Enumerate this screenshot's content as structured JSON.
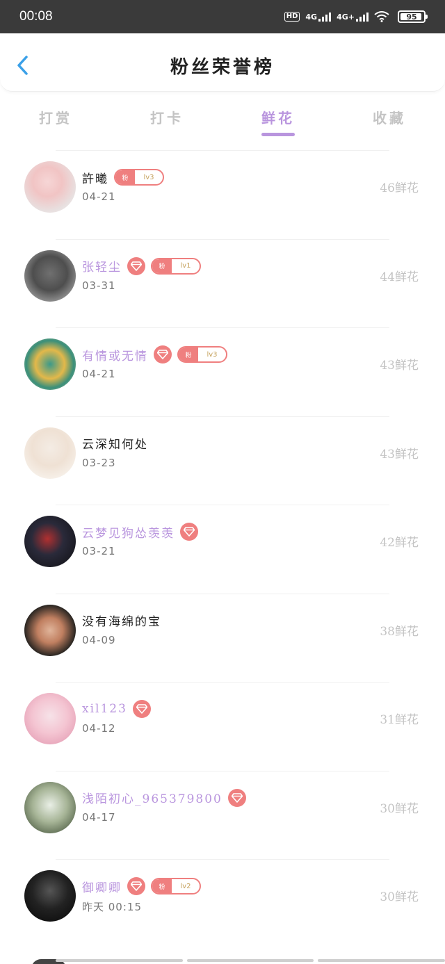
{
  "status_bar": {
    "time": "00:08",
    "hd_label": "HD",
    "net1": "4G",
    "net2": "4G+",
    "battery": "95",
    "battery_level": 0.95
  },
  "header": {
    "title": "粉丝荣誉榜"
  },
  "tabs": [
    {
      "label": "打赏",
      "active": false
    },
    {
      "label": "打卡",
      "active": false
    },
    {
      "label": "鲜花",
      "active": true
    },
    {
      "label": "收藏",
      "active": false
    }
  ],
  "colors": {
    "accent": "#b995de",
    "badge": "#ef7f7f",
    "muted": "#c4c4c4"
  },
  "fans": [
    {
      "name": "許曦",
      "vip": false,
      "diamond": false,
      "level": "lv3",
      "badge_char": "粉",
      "date": "04-21",
      "count": "46鲜花"
    },
    {
      "name": "张轻尘",
      "vip": true,
      "diamond": true,
      "level": "lv1",
      "badge_char": "粉",
      "date": "03-31",
      "count": "44鲜花"
    },
    {
      "name": "有情或无情",
      "vip": true,
      "diamond": true,
      "level": "lv3",
      "badge_char": "粉",
      "date": "04-21",
      "count": "43鲜花"
    },
    {
      "name": "云深知何处",
      "vip": false,
      "diamond": false,
      "level": "",
      "badge_char": "",
      "date": "03-23",
      "count": "43鲜花"
    },
    {
      "name": "云梦见狗怂羡羡",
      "vip": true,
      "diamond": true,
      "level": "",
      "badge_char": "",
      "date": "03-21",
      "count": "42鲜花"
    },
    {
      "name": "没有海绵的宝",
      "vip": false,
      "diamond": false,
      "level": "",
      "badge_char": "",
      "date": "04-09",
      "count": "38鲜花"
    },
    {
      "name": "xil123",
      "vip": true,
      "diamond": true,
      "level": "",
      "badge_char": "",
      "date": "04-12",
      "count": "31鲜花"
    },
    {
      "name": "浅陌初心_965379800",
      "vip": true,
      "diamond": true,
      "level": "",
      "badge_char": "",
      "date": "04-17",
      "count": "30鲜花"
    },
    {
      "name": "御卿卿",
      "vip": true,
      "diamond": true,
      "level": "lv2",
      "badge_char": "粉",
      "date": "昨天 00:15",
      "count": "30鲜花"
    }
  ]
}
